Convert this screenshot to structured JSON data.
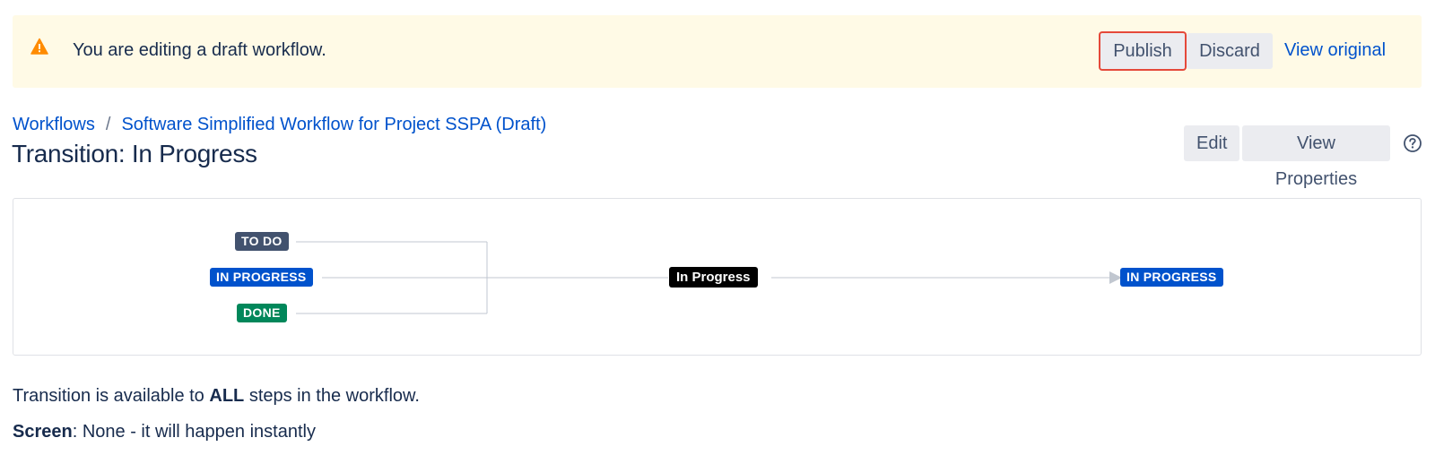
{
  "banner": {
    "icon": "warning-icon",
    "message": "You are editing a draft workflow.",
    "publish_label": "Publish",
    "discard_label": "Discard",
    "view_original_label": "View original",
    "background": "#fffae6"
  },
  "breadcrumb": {
    "root": "Workflows",
    "separator": "/",
    "current": "Software Simplified Workflow for Project SSPA (Draft)"
  },
  "page": {
    "title": "Transition: In Progress",
    "edit_label": "Edit",
    "view_properties_label": "View Properties",
    "help_icon": "help-icon"
  },
  "diagram": {
    "from_statuses": [
      "TO DO",
      "IN PROGRESS",
      "DONE"
    ],
    "transition": "In Progress",
    "to_status": "IN PROGRESS",
    "colors": {
      "todo": "#42526e",
      "in_progress": "#0052cc",
      "done": "#00875a",
      "transition": "#000000"
    }
  },
  "info": {
    "availability_prefix": "Transition is available to ",
    "availability_bold": "ALL",
    "availability_suffix": " steps in the workflow.",
    "screen_label": "Screen",
    "screen_value": ": None - it will happen instantly"
  }
}
